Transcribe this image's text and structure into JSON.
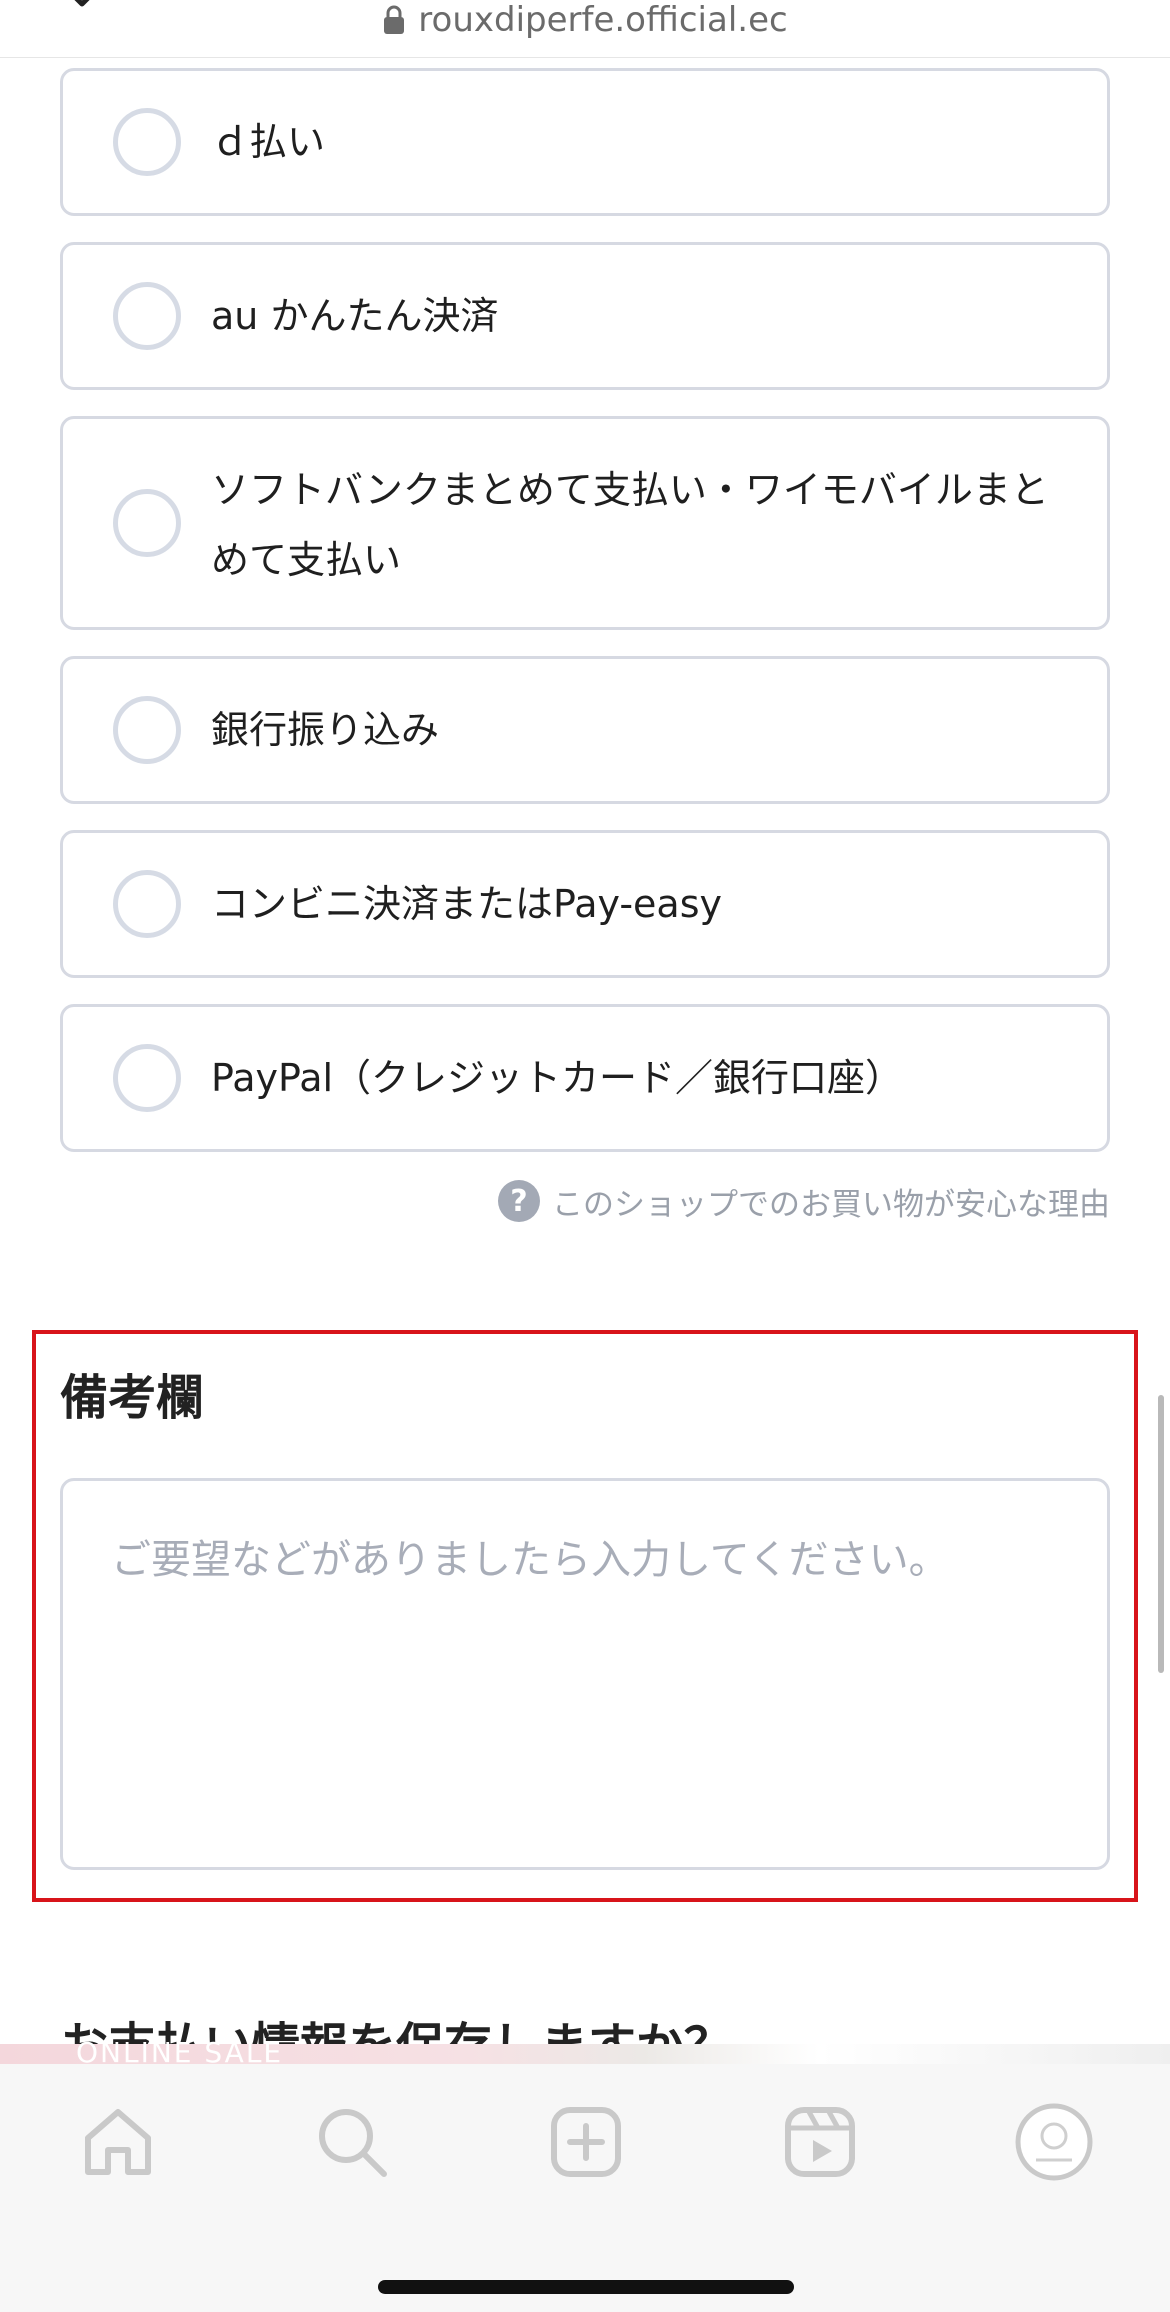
{
  "browser": {
    "url": "rouxdiperfe.official.ec"
  },
  "payment_options": [
    {
      "label": "ｄ払い"
    },
    {
      "label": "au かんたん決済"
    },
    {
      "label": "ソフトバンクまとめて支払い・ワイモバイルまとめて支払い"
    },
    {
      "label": "銀行振り込み"
    },
    {
      "label": "コンビニ決済またはPay-easy"
    },
    {
      "label": "PayPal（クレジットカード／銀行口座）"
    }
  ],
  "help_link": "このショップでのお買い物が安心な理由",
  "notes": {
    "title": "備考欄",
    "placeholder": "ご要望などがありましたら入力してください。"
  },
  "save_payment_heading": "お支払い情報を保存しますか？",
  "banner_text": "ONLINE SALE",
  "bottom_nav": [
    {
      "icon": "home-icon"
    },
    {
      "icon": "search-icon"
    },
    {
      "icon": "add-icon"
    },
    {
      "icon": "reels-icon"
    },
    {
      "icon": "profile-avatar"
    }
  ],
  "colors": {
    "highlight_border": "#d8141a",
    "option_border": "#d6d9e2",
    "muted_text": "#9aa0aa"
  }
}
